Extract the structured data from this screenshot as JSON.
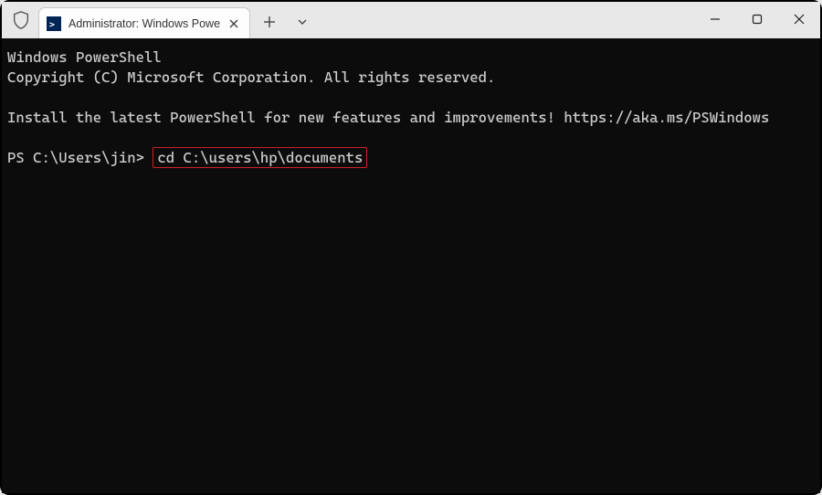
{
  "tab": {
    "title": "Administrator: Windows Powe"
  },
  "terminal": {
    "line1": "Windows PowerShell",
    "line2": "Copyright (C) Microsoft Corporation. All rights reserved.",
    "line3": "Install the latest PowerShell for new features and improvements! https://aka.ms/PSWindows",
    "prompt": "PS C:\\Users\\jin>",
    "command": "cd C:\\users\\hp\\documents"
  },
  "icons": {
    "ps_glyph": ">_"
  }
}
